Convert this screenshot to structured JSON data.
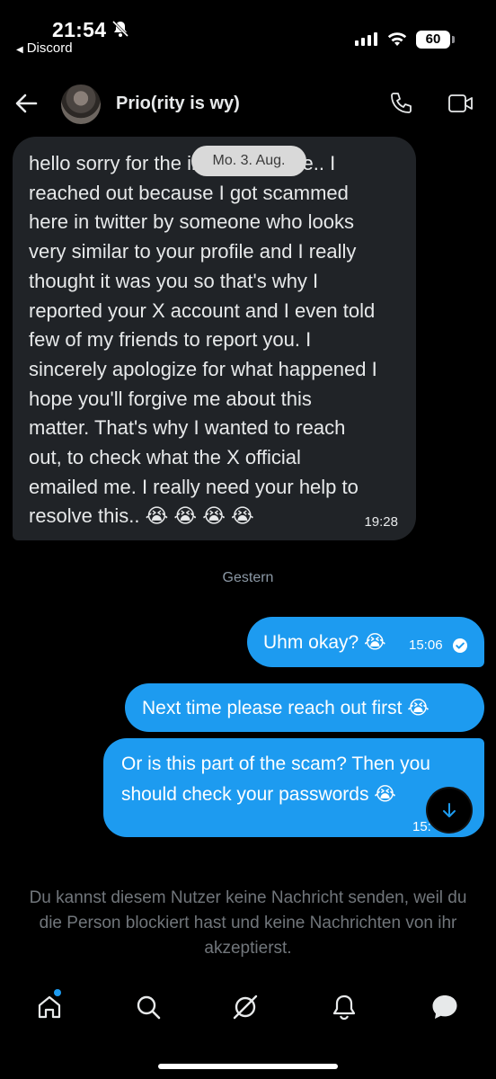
{
  "status_bar": {
    "time": "21:54",
    "back_app": "Discord",
    "battery": "60"
  },
  "header": {
    "contact_name": "Prio(rity is wy)",
    "icons": [
      "back-arrow-icon",
      "phone-icon",
      "video-icon"
    ]
  },
  "conversation": {
    "date_pill": "Mo. 3. Aug.",
    "incoming": {
      "lines": [
        "hello sorry for the inconvenience.. I",
        "reached out because I got scammed",
        "here in twitter by someone who looks",
        "very similar to your profile and I really",
        "thought it was you so that's why I",
        "reported your X account and I even told",
        "few of my friends to report you. I",
        "sincerely apologize for what happened I",
        "hope you'll forgive me about this",
        "matter. That's why I wanted to reach",
        "out, to check what the X official",
        "emailed me. I really need your help to",
        "resolve this.. 😭 😭 😭 😭"
      ],
      "time": "19:28"
    },
    "day_divider": "Gestern",
    "outgoing": [
      {
        "text": "Uhm okay? 😭",
        "time": "15:06"
      },
      {
        "text": "Next time please reach out first 😭"
      },
      {
        "line1": "Or is this part of the scam? Then you",
        "line2": "should check your passwords 😭",
        "time": "15:"
      }
    ]
  },
  "blocked_notice": "Du kannst diesem Nutzer keine Nachricht senden, weil du die Person blockiert hast und keine Nachrichten von ihr akzeptierst.",
  "bottom_nav": [
    "home-icon",
    "search-icon",
    "grok-icon",
    "notifications-icon",
    "messages-icon"
  ],
  "colors": {
    "accent": "#1d9bf0",
    "incoming_bubble": "#202327",
    "muted_text": "#71767b",
    "background": "#000000"
  }
}
